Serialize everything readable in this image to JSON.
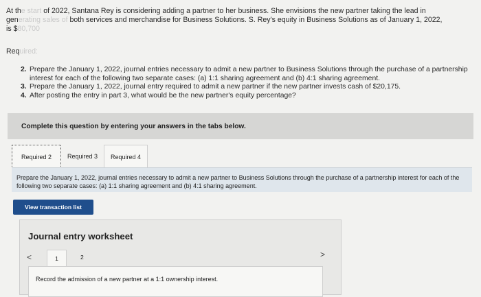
{
  "intro": {
    "part1": "At th",
    "faded1": "e start",
    "part2": " of 2022, Santana Rey is considering adding a partner to her business. She envisions the new partner taking the lead in",
    "part3": "gen",
    "faded2": "erating sales of",
    "part4": " both services and merchandise for Business Solutions. S. Rey's equity in Business Solutions as of January 1, 2022,",
    "part5": "is $",
    "faded3": "80,700"
  },
  "required_label": {
    "visible": "Req",
    "faded": "uired:"
  },
  "requirements": [
    {
      "num": "2.",
      "text": "Prepare the January 1, 2022, journal entries necessary to admit a new partner to Business Solutions through the purchase of a partnership interest for each of the following two separate cases: (a) 1:1 sharing agreement and (b) 4:1 sharing agreement."
    },
    {
      "num": "3.",
      "text": "Prepare the January 1, 2022, journal entry required to admit a new partner if the new partner invests cash of $20,175."
    },
    {
      "num": "4.",
      "text": "After posting the entry in part 3, what would be the new partner's equity percentage?"
    }
  ],
  "banner": "Complete this question by entering your answers in the tabs below.",
  "tabs": [
    {
      "label": "Required 2",
      "active": true
    },
    {
      "label": "Required 3",
      "active": false
    },
    {
      "label": "Required 4",
      "active": false
    }
  ],
  "panel_text": "Prepare the January 1, 2022, journal entries necessary to admit a new partner to Business Solutions through the purchase of a partnership interest for each of the following two separate cases: (a) 1:1 sharing agreement and (b) 4:1 sharing agreement.",
  "view_button": "View transaction list",
  "worksheet": {
    "title": "Journal entry worksheet",
    "prev": "<",
    "next": ">",
    "pages": [
      "1",
      "2"
    ],
    "instruction": "Record the admission of a new partner at a 1:1 ownership interest."
  }
}
